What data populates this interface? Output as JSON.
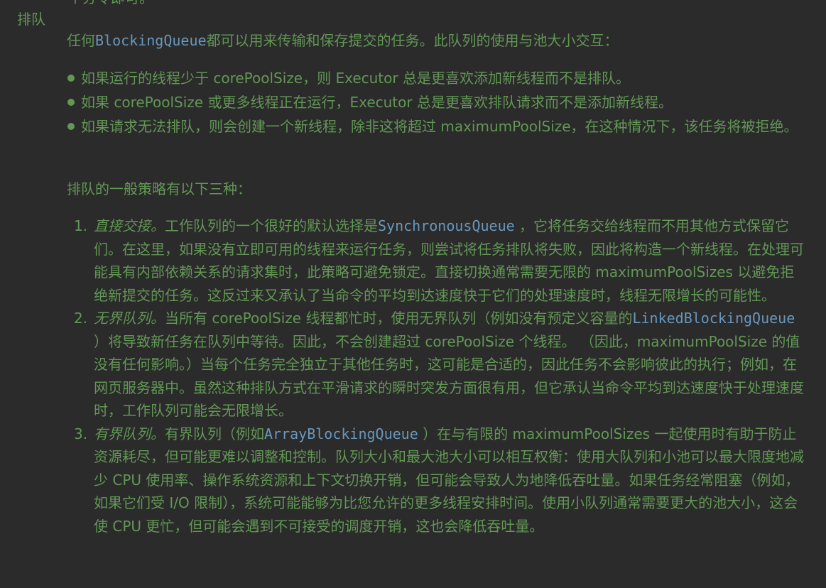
{
  "top_fragment": "个分令即可。",
  "section_label": "排队",
  "intro": {
    "prefix": "任何",
    "code": "BlockingQueue",
    "suffix": "都可以用来传输和保存提交的任务。此队列的使用与池大小交互："
  },
  "bullets": [
    "如果运行的线程少于 corePoolSize，则 Executor 总是更喜欢添加新线程而不是排队。",
    "如果 corePoolSize 或更多线程正在运行，Executor 总是更喜欢排队请求而不是添加新线程。",
    "如果请求无法排队，则会创建一个新线程，除非这将超过 maximumPoolSize，在这种情况下，该任务将被拒绝。"
  ],
  "strategy_intro": "排队的一般策略有以下三种：",
  "strategies": [
    {
      "number": "1.",
      "title": "直接交接。",
      "before_code": "工作队列的一个很好的默认选择是",
      "code": "SynchronousQueue",
      "after_code": " ，它将任务交给线程而不用其他方式保留它们。在这里，如果没有立即可用的线程来运行任务，则尝试将任务排队将失败，因此将构造一个新线程。在处理可能具有内部依赖关系的请求集时，此策略可避免锁定。直接切换通常需要无限的 maximumPoolSizes 以避免拒绝新提交的任务。这反过来又承认了当命令的平均到达速度快于它们的处理速度时，线程无限增长的可能性。"
    },
    {
      "number": "2.",
      "title": "无界队列。",
      "before_code": "当所有 corePoolSize 线程都忙时，使用无界队列（例如没有预定义容量的",
      "code": "LinkedBlockingQueue",
      "after_code": " ）将导致新任务在队列中等待。因此，不会创建超过 corePoolSize 个线程。 （因此，maximumPoolSize 的值没有任何影响。）当每个任务完全独立于其他任务时，这可能是合适的，因此任务不会影响彼此的执行；例如，在网页服务器中。虽然这种排队方式在平滑请求的瞬时突发方面很有用，但它承认当命令平均到达速度快于处理速度时，工作队列可能会无限增长。"
    },
    {
      "number": "3.",
      "title": "有界队列。",
      "before_code": "有界队列（例如",
      "code": "ArrayBlockingQueue",
      "after_code": " ）在与有限的 maximumPoolSizes 一起使用时有助于防止资源耗尽，但可能更难以调整和控制。队列大小和最大池大小可以相互权衡：使用大队列和小池可以最大限度地减少 CPU 使用率、操作系统资源和上下文切换开销，但可能会导致人为地降低吞吐量。如果任务经常阻塞（例如，如果它们受 I/O 限制），系统可能能够为比您允许的更多线程安排时间。使用小队列通常需要更大的池大小，这会使 CPU 更忙，但可能会遇到不可接受的调度开销，这也会降低吞吐量。"
    }
  ],
  "colors": {
    "background": "#2b2b2b",
    "doc_text": "#629755",
    "code_ref": "#6897bb"
  }
}
